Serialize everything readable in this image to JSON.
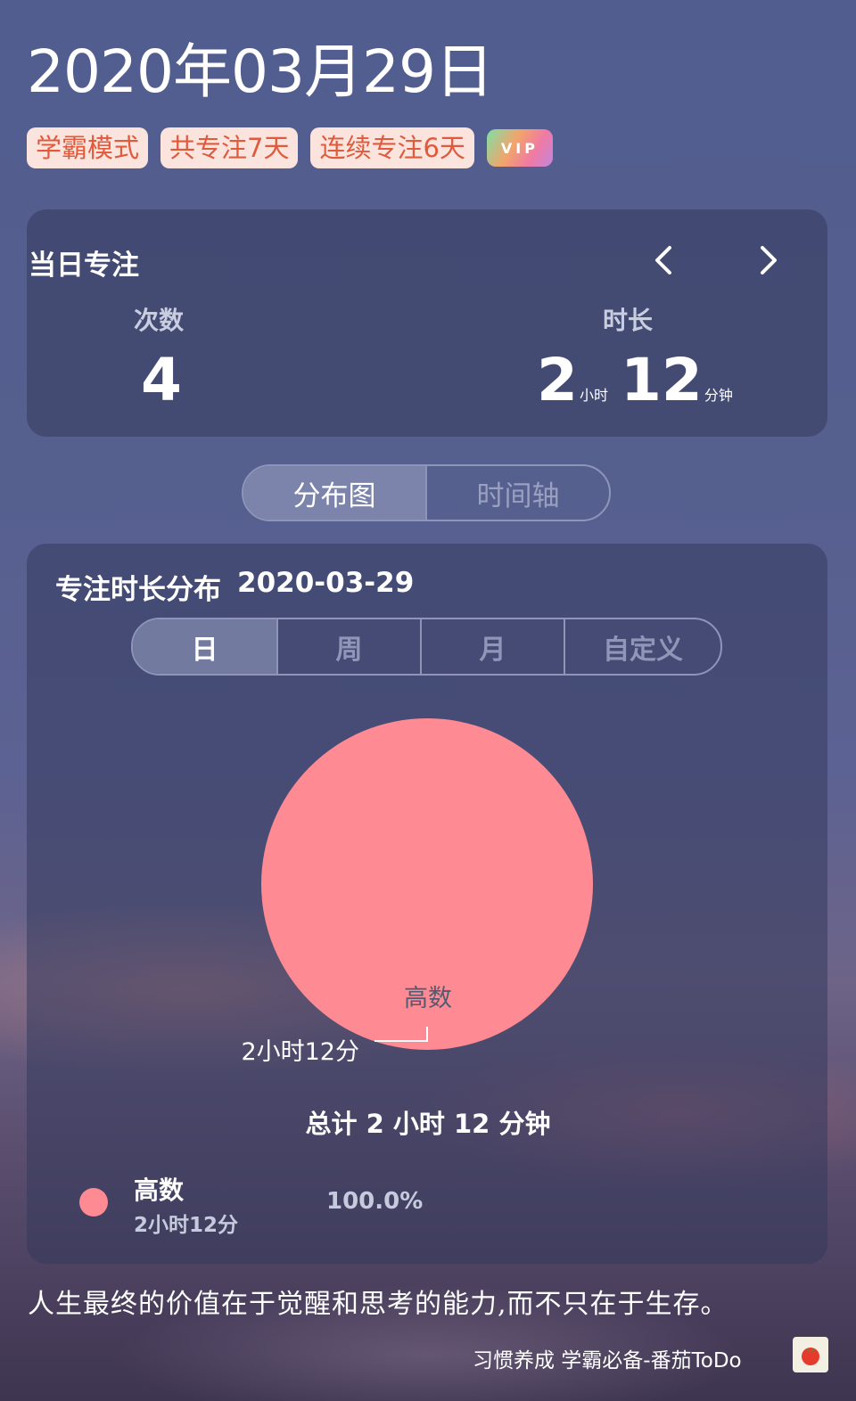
{
  "header": {
    "date_title": "2020年03月29日",
    "tags": [
      "学霸模式",
      "共专注7天",
      "连续专注6天"
    ],
    "vip_badge": "VIP"
  },
  "daily": {
    "title": "当日专注",
    "prev_icon": "chevron-left-icon",
    "next_icon": "chevron-right-icon",
    "count_label": "次数",
    "count_value": "4",
    "duration_label": "时长",
    "hours": "2",
    "hours_unit": "小时",
    "minutes": "12",
    "minutes_unit": "分钟"
  },
  "view_tabs": [
    "分布图",
    "时间轴"
  ],
  "view_tab_active": 0,
  "distribution": {
    "title": "专注时长分布",
    "date": "2020-03-29",
    "range_tabs": [
      "日",
      "周",
      "月",
      "自定义"
    ],
    "range_active": 0,
    "pie_label": "高数",
    "pie_value_label": "2小时12分",
    "total": "总计 2 小时 12 分钟",
    "legend": [
      {
        "name": "高数",
        "duration": "2小时12分",
        "percent": "100.0%",
        "color": "#fe8a93"
      }
    ]
  },
  "chart_data": {
    "type": "pie",
    "categories": [
      "高数"
    ],
    "values": [
      132
    ],
    "colors": [
      "#fe8a93"
    ],
    "data_labels": [
      "2小时12分"
    ]
  },
  "footer": {
    "quote": "人生最终的价值在于觉醒和思考的能力,而不只在于生存。",
    "app_slogan": "习惯养成 学霸必备-番茄ToDo",
    "logo_icon": "tomato-logo-icon"
  }
}
